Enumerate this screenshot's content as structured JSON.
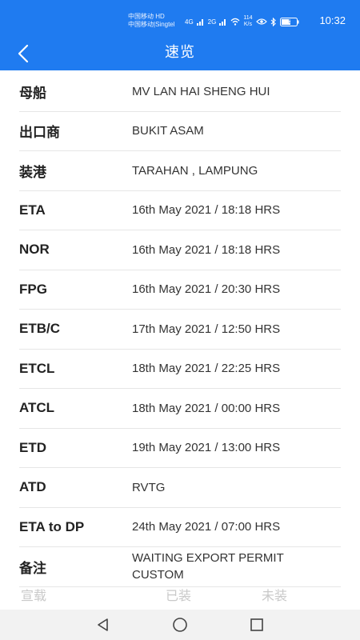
{
  "status_bar": {
    "carrier_line1": "中国移动 HD",
    "carrier_line2": "中国移动|Singtel",
    "signal1": "4G",
    "signal2": "2G",
    "net_speed_value": "114",
    "net_speed_unit": "K/s",
    "battery": "58",
    "time": "10:32"
  },
  "header": {
    "title": "速览"
  },
  "rows": [
    {
      "label": "母船",
      "value": "MV LAN HAI SHENG HUI"
    },
    {
      "label": "出口商",
      "value": "BUKIT ASAM"
    },
    {
      "label": "装港",
      "value": "TARAHAN , LAMPUNG"
    },
    {
      "label": "ETA",
      "value": "16th May 2021 / 18:18 HRS"
    },
    {
      "label": "NOR",
      "value": "16th May 2021 / 18:18 HRS"
    },
    {
      "label": "FPG",
      "value": "16th May 2021 / 20:30 HRS"
    },
    {
      "label": "ETB/C",
      "value": "17th May 2021 / 12:50 HRS"
    },
    {
      "label": "ETCL",
      "value": "18th May 2021 / 22:25 HRS"
    },
    {
      "label": "ATCL",
      "value": "18th May 2021 / 00:00 HRS"
    },
    {
      "label": "ETD",
      "value": "19th May 2021 / 13:00 HRS"
    },
    {
      "label": "ATD",
      "value": "RVTG"
    },
    {
      "label": "ETA to DP",
      "value": "24th May 2021 / 07:00 HRS"
    },
    {
      "label": "备注",
      "value": "WAITING EXPORT PERMIT CUSTOM"
    }
  ],
  "bottom_tabs": [
    {
      "label": "宣载"
    },
    {
      "label": "已装"
    },
    {
      "label": "未装"
    }
  ],
  "colors": {
    "accent": "#1f7bf0",
    "tab_inactive": "#c9c9c9"
  },
  "icons": {
    "back": "chevron-left-icon",
    "nav_back": "triangle-back-icon",
    "nav_home": "circle-home-icon",
    "nav_recent": "square-recent-icon"
  }
}
